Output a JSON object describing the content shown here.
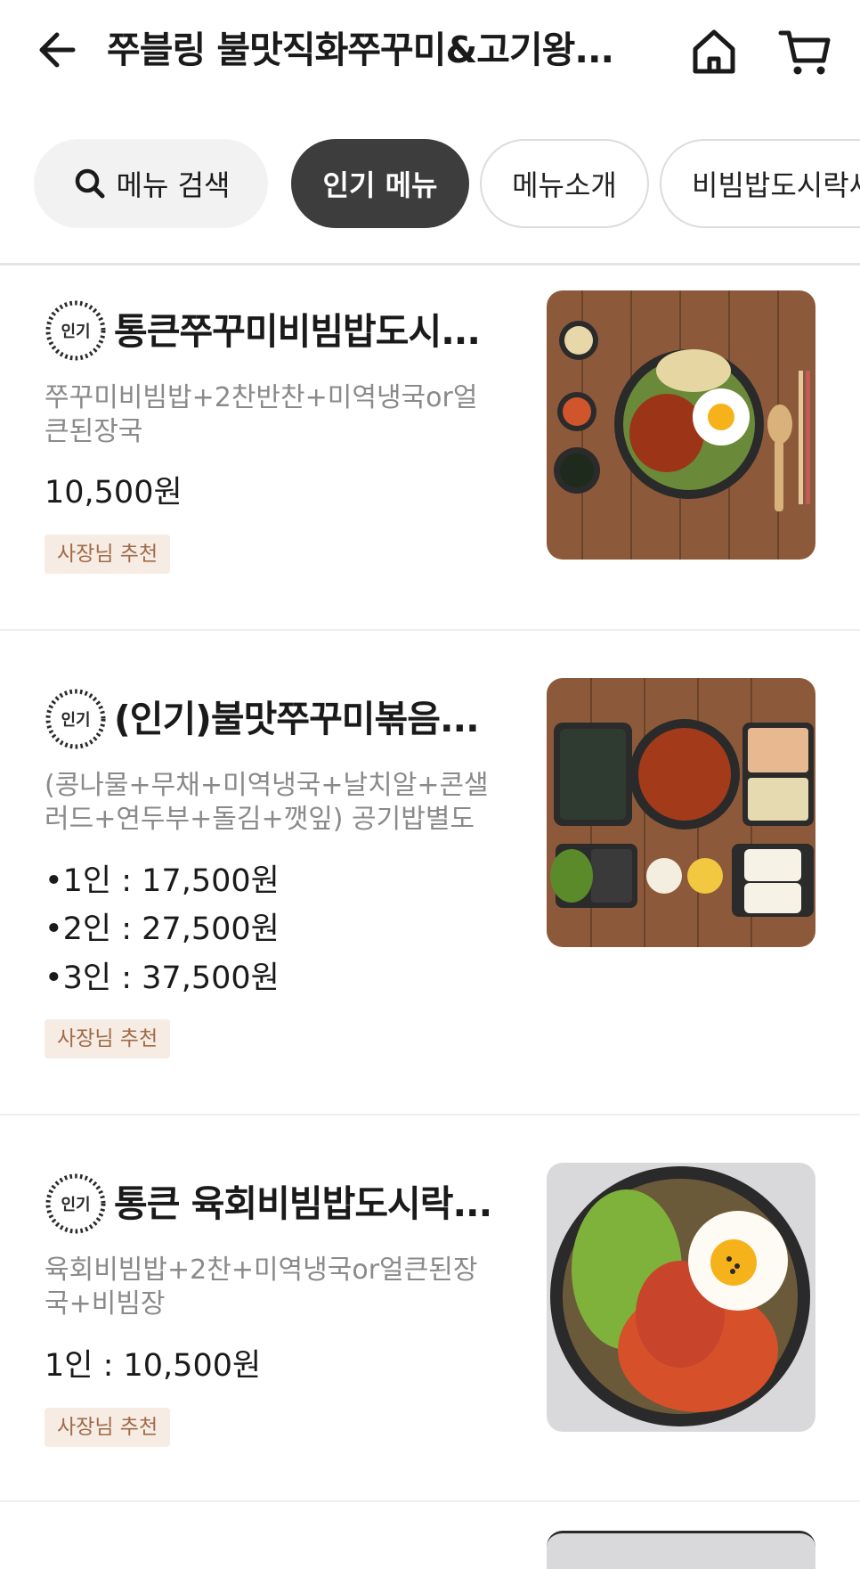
{
  "header": {
    "title": "쭈블링 불맛직화쭈꾸미&고기왕...",
    "back_icon": "arrow-left-icon",
    "home_icon": "home-icon",
    "cart_icon": "cart-icon"
  },
  "tabs": {
    "search_label": "메뉴 검색",
    "items": [
      {
        "label": "인기 메뉴",
        "active": true
      },
      {
        "label": "메뉴소개",
        "active": false
      },
      {
        "label": "비빔밥도시락세트",
        "active": false
      }
    ]
  },
  "badge_text": "인기",
  "menu": [
    {
      "name": "통큰쭈꾸미비빔밥도시...",
      "desc": [
        "쭈꾸미비빔밥+2찬반찬+미역냉국or얼",
        "큰된장국"
      ],
      "prices": [
        "10,500원"
      ],
      "tag": "사장님 추천"
    },
    {
      "name": "(인기)불맛쭈꾸미볶음...",
      "desc": [
        "(콩나물+무채+미역냉국+날치알+콘샐",
        "러드+연두부+돌김+깻잎) 공기밥별도"
      ],
      "prices": [
        "•1인 : 17,500원",
        "•2인 : 27,500원",
        "•3인 : 37,500원"
      ],
      "tag": "사장님 추천"
    },
    {
      "name": "통큰 육회비빔밥도시락...",
      "desc": [
        "육회비빔밥+2찬+미역냉국or얼큰된장",
        "국+비빔장"
      ],
      "prices": [
        "1인 : 10,500원"
      ],
      "tag": "사장님 추천"
    }
  ],
  "colors": {
    "active_chip": "#3d3d3d",
    "tag_bg": "#f6ece4",
    "tag_text": "#a06a48",
    "desc_text": "#8a8a8a"
  }
}
